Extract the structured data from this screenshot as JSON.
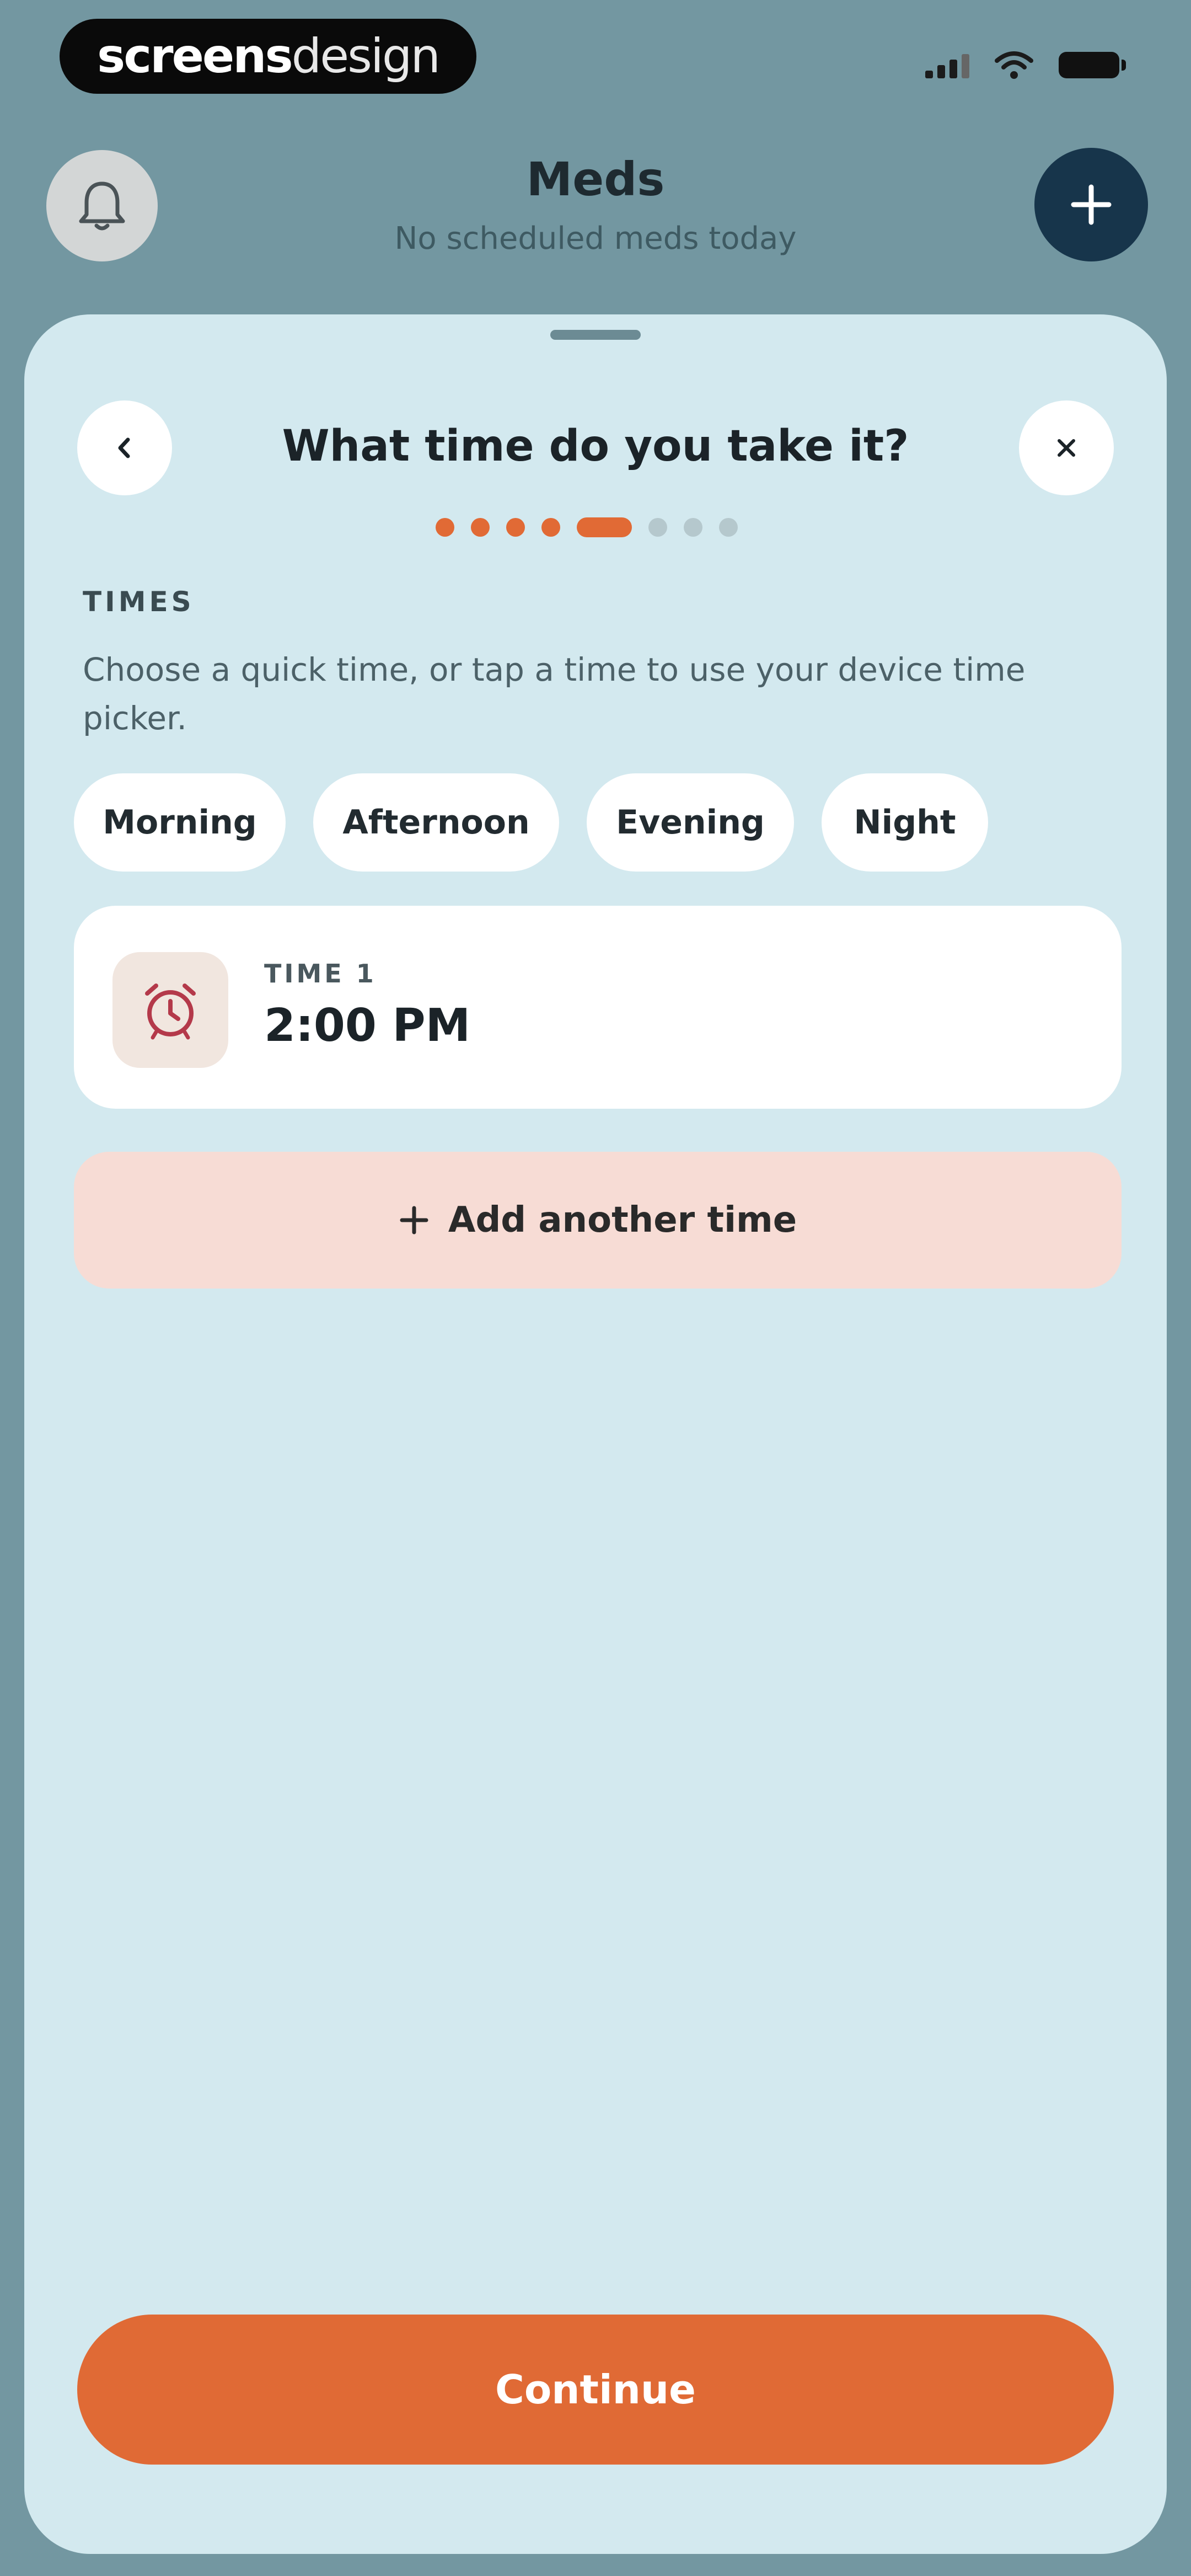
{
  "status_bar": {
    "brand_part1": "screens",
    "brand_part2": "design"
  },
  "header": {
    "title": "Meds",
    "subtitle": "No scheduled meds today"
  },
  "sheet": {
    "title": "What time do you take it?",
    "progress": {
      "total_steps": 8,
      "current_step": 5
    },
    "section_label": "TIMES",
    "helper_text": "Choose a quick time, or tap a time to use your device time picker.",
    "quick_times": [
      "Morning",
      "Afternoon",
      "Evening",
      "Night"
    ],
    "time_entry": {
      "label": "TIME 1",
      "value": "2:00 PM"
    },
    "add_button_label": "Add another time",
    "continue_label": "Continue"
  },
  "colors": {
    "background": "#7397a1",
    "sheet": "#d3e9ef",
    "accent": "#e06a35",
    "primary_dark": "#17354b",
    "add_button_bg": "#f7dcd5"
  },
  "icons": {
    "bell": "bell-icon",
    "plus": "plus-icon",
    "back": "chevron-left-icon",
    "close": "close-icon",
    "alarm": "alarm-clock-icon",
    "signal": "cellular-signal-icon",
    "wifi": "wifi-icon",
    "battery": "battery-icon"
  }
}
